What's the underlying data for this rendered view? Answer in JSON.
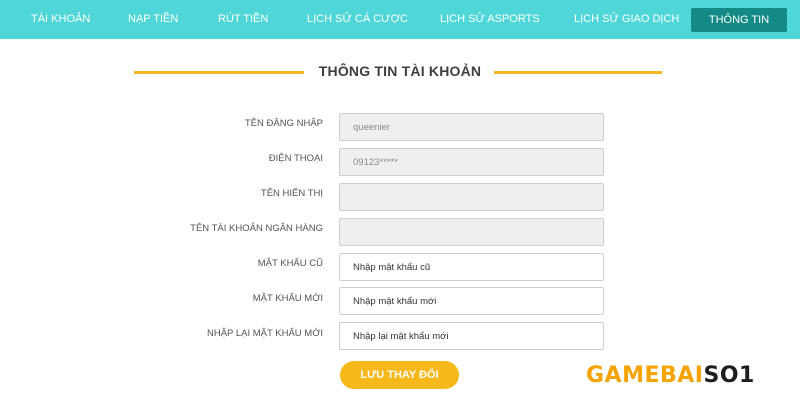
{
  "nav": {
    "items": [
      {
        "label": "TÀI KHOẢN"
      },
      {
        "label": "NẠP TIỀN"
      },
      {
        "label": "RÚT TIỀN"
      },
      {
        "label": "LỊCH SỬ CÁ CƯỢC"
      },
      {
        "label": "LỊCH SỬ ASPORTS"
      },
      {
        "label": "LỊCH SỬ GIAO DỊCH"
      },
      {
        "label": "THÔNG TIN"
      }
    ],
    "active_index": 6
  },
  "form": {
    "title": "THÔNG TIN TÀI KHOẢN",
    "fields": [
      {
        "label": "TÊN ĐĂNG NHẬP",
        "value": "queenier",
        "placeholder": "",
        "readonly": true
      },
      {
        "label": "ĐIỆN THOẠI",
        "value": "09123*****",
        "placeholder": "",
        "readonly": true
      },
      {
        "label": "TÊN HIỂN THỊ",
        "value": "",
        "placeholder": "",
        "readonly": true
      },
      {
        "label": "TÊN TÀI KHOẢN NGÂN HÀNG",
        "value": "",
        "placeholder": "",
        "readonly": true
      },
      {
        "label": "MẬT KHẨU CŨ",
        "value": "",
        "placeholder": "Nhập mật khẩu cũ",
        "readonly": false
      },
      {
        "label": "MẬT KHẨU MỚI",
        "value": "",
        "placeholder": "Nhập mật khẩu mới",
        "readonly": false
      },
      {
        "label": "NHẬP LẠI MẬT KHẨU MỚI",
        "value": "",
        "placeholder": "Nhập lại mật khẩu mới",
        "readonly": false
      }
    ],
    "save_label": "LƯU THAY ĐỔI"
  },
  "watermark": {
    "part1": "GAMEBAI",
    "part2": "SO1"
  },
  "colors": {
    "nav_bg": "#4fd6d8",
    "nav_active": "#138a86",
    "accent": "#f5b625",
    "button": "#f6b81a"
  }
}
